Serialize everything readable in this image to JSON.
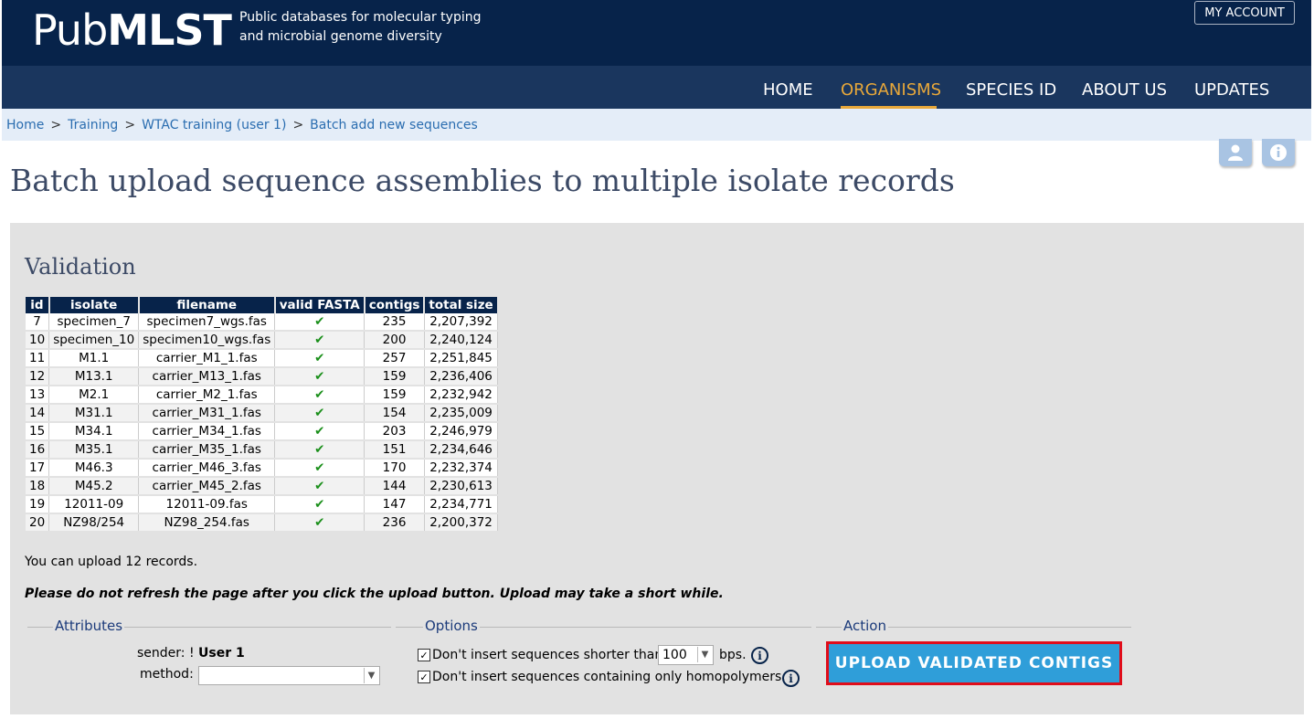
{
  "header": {
    "logo_regular": "Pub",
    "logo_bold": "MLST",
    "tagline_line1": "Public databases for molecular typing",
    "tagline_line2": "and microbial genome diversity",
    "account_button": "MY ACCOUNT"
  },
  "nav": {
    "items": [
      {
        "label": "HOME",
        "active": false
      },
      {
        "label": "ORGANISMS",
        "active": true
      },
      {
        "label": "SPECIES ID",
        "active": false
      },
      {
        "label": "ABOUT US",
        "active": false
      },
      {
        "label": "UPDATES",
        "active": false
      }
    ]
  },
  "breadcrumb": {
    "items": [
      "Home",
      "Training",
      "WTAC training (user 1)",
      "Batch add new sequences"
    ],
    "separator": ">"
  },
  "icons": {
    "user": "user-icon",
    "info": "info-icon"
  },
  "page_title": "Batch upload sequence assemblies to multiple isolate records",
  "validation": {
    "heading": "Validation",
    "columns": [
      "id",
      "isolate",
      "filename",
      "valid FASTA",
      "contigs",
      "total size"
    ],
    "rows": [
      {
        "id": "7",
        "isolate": "specimen_7",
        "filename": "specimen7_wgs.fas",
        "valid": true,
        "contigs": "235",
        "total_size": "2,207,392"
      },
      {
        "id": "10",
        "isolate": "specimen_10",
        "filename": "specimen10_wgs.fas",
        "valid": true,
        "contigs": "200",
        "total_size": "2,240,124"
      },
      {
        "id": "11",
        "isolate": "M1.1",
        "filename": "carrier_M1_1.fas",
        "valid": true,
        "contigs": "257",
        "total_size": "2,251,845"
      },
      {
        "id": "12",
        "isolate": "M13.1",
        "filename": "carrier_M13_1.fas",
        "valid": true,
        "contigs": "159",
        "total_size": "2,236,406"
      },
      {
        "id": "13",
        "isolate": "M2.1",
        "filename": "carrier_M2_1.fas",
        "valid": true,
        "contigs": "159",
        "total_size": "2,232,942"
      },
      {
        "id": "14",
        "isolate": "M31.1",
        "filename": "carrier_M31_1.fas",
        "valid": true,
        "contigs": "154",
        "total_size": "2,235,009"
      },
      {
        "id": "15",
        "isolate": "M34.1",
        "filename": "carrier_M34_1.fas",
        "valid": true,
        "contigs": "203",
        "total_size": "2,246,979"
      },
      {
        "id": "16",
        "isolate": "M35.1",
        "filename": "carrier_M35_1.fas",
        "valid": true,
        "contigs": "151",
        "total_size": "2,234,646"
      },
      {
        "id": "17",
        "isolate": "M46.3",
        "filename": "carrier_M46_3.fas",
        "valid": true,
        "contigs": "170",
        "total_size": "2,232,374"
      },
      {
        "id": "18",
        "isolate": "M45.2",
        "filename": "carrier_M45_2.fas",
        "valid": true,
        "contigs": "144",
        "total_size": "2,230,613"
      },
      {
        "id": "19",
        "isolate": "12011-09",
        "filename": "12011-09.fas",
        "valid": true,
        "contigs": "147",
        "total_size": "2,234,771"
      },
      {
        "id": "20",
        "isolate": "NZ98/254",
        "filename": "NZ98_254.fas",
        "valid": true,
        "contigs": "236",
        "total_size": "2,200,372"
      }
    ],
    "check_glyph": "✔",
    "upload_count_text": "You can upload 12 records.",
    "warning_text": "Please do not refresh the page after you click the upload button. Upload may take a short while."
  },
  "attributes": {
    "legend": "Attributes",
    "sender_label": "sender: !",
    "sender_value": "User 1",
    "method_label": "method:",
    "method_value": ""
  },
  "options": {
    "legend": "Options",
    "min_length_label": "Don't insert sequences shorter than",
    "min_length_value": "100",
    "min_length_unit": "bps.",
    "min_length_checked": true,
    "homopolymer_label": "Don't insert sequences containing only homopolymers.",
    "homopolymer_checked": true
  },
  "action": {
    "legend": "Action",
    "button_label": "UPLOAD VALIDATED CONTIGS"
  },
  "colors": {
    "header_bg": "#07234a",
    "nav_bg": "#1a365e",
    "active_nav": "#e8a83a",
    "button_bg": "#2f9ed9",
    "button_border": "#e00d1a",
    "check": "#1a8f1a"
  }
}
